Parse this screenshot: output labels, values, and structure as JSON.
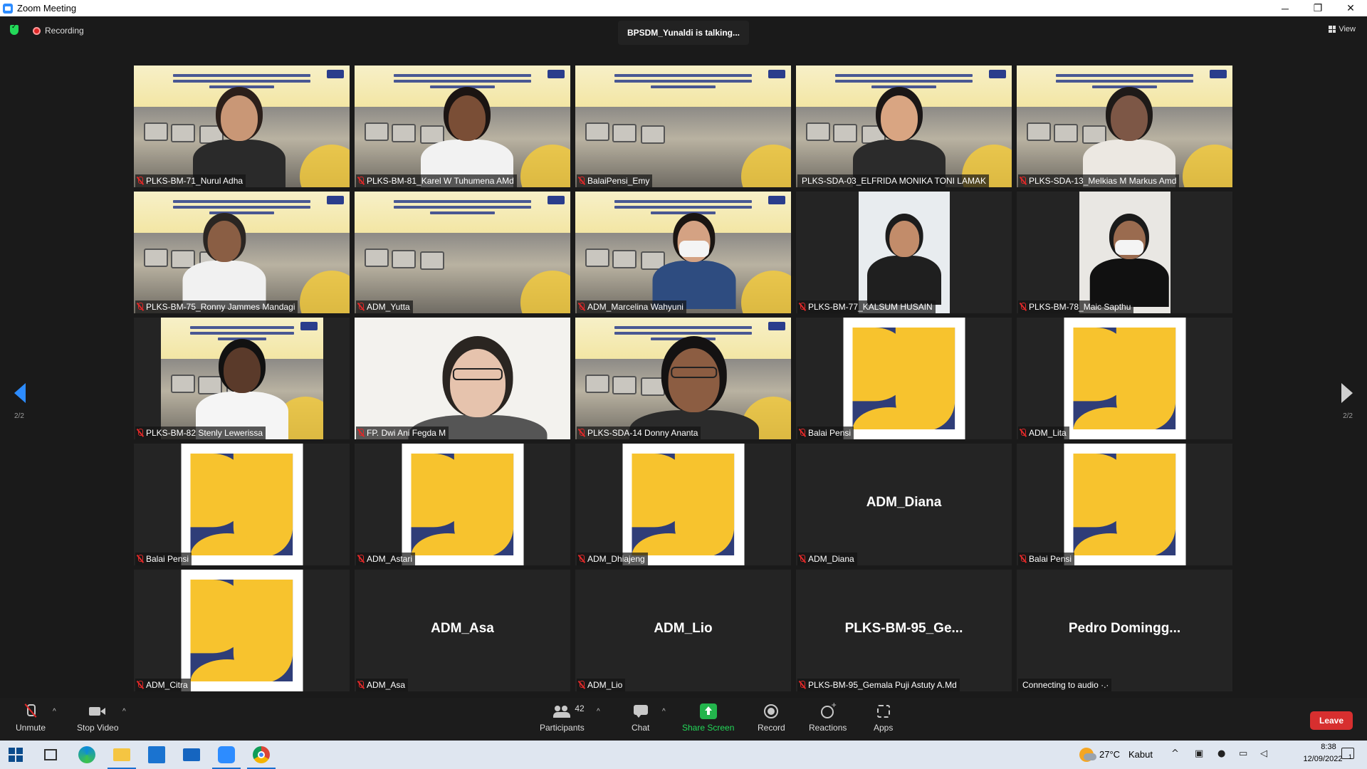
{
  "window": {
    "title": "Zoom Meeting",
    "controls": [
      "─",
      "❐",
      "✕"
    ]
  },
  "top": {
    "recording_label": "Recording",
    "talking": "BPSDM_Yunaldi is talking...",
    "view_label": "View"
  },
  "pagination": {
    "left": "2/2",
    "right": "2/2"
  },
  "colors": {
    "pu_yellow": "#f7c32e",
    "pu_blue": "#2f3d78",
    "accent": "#2d8cff",
    "leave": "#d72f2f"
  },
  "tiles": [
    {
      "name": "PLKS-BM-71_Nurul Adha",
      "kind": "video",
      "muted": true
    },
    {
      "name": "PLKS-BM-81_Karel W Tuhumena AMd",
      "kind": "video",
      "muted": true
    },
    {
      "name": "BalaiPensi_Emy",
      "kind": "video",
      "muted": true
    },
    {
      "name": "PLKS-SDA-03_ELFRIDA MONIKA TONI LAMAK",
      "kind": "video",
      "muted": false
    },
    {
      "name": "PLKS-SDA-13_Melkias M Markus Amd",
      "kind": "video",
      "muted": true
    },
    {
      "name": "PLKS-BM-75_Ronny Jammes Mandagi",
      "kind": "video",
      "muted": true
    },
    {
      "name": "ADM_Yutta",
      "kind": "video",
      "muted": true
    },
    {
      "name": "ADM_Marcelina Wahyuni",
      "kind": "video",
      "muted": true
    },
    {
      "name": "PLKS-BM-77_KALSUM HUSAIN",
      "kind": "video",
      "muted": true
    },
    {
      "name": "PLKS-BM-78_Maic Sapthu",
      "kind": "video",
      "muted": true
    },
    {
      "name": "PLKS-BM-82 Stenly Lewerissa",
      "kind": "video",
      "muted": true
    },
    {
      "name": "FP. Dwi Ani Fegda M",
      "kind": "video",
      "muted": true
    },
    {
      "name": "PLKS-SDA-14 Donny Ananta",
      "kind": "video",
      "muted": true
    },
    {
      "name": "Balai Pensi",
      "kind": "logo",
      "muted": true
    },
    {
      "name": "ADM_Lita",
      "kind": "logo",
      "muted": true
    },
    {
      "name": "Balai Pensi",
      "kind": "logo",
      "muted": true
    },
    {
      "name": "ADM_Astari",
      "kind": "logo",
      "muted": true
    },
    {
      "name": "ADM_Dhiajeng",
      "kind": "logo",
      "muted": true
    },
    {
      "name": "ADM_Diana",
      "kind": "text",
      "display": "ADM_Diana",
      "muted": true
    },
    {
      "name": "Balai Pensi",
      "kind": "logo",
      "muted": true
    },
    {
      "name": "ADM_Citra",
      "kind": "logo",
      "muted": true
    },
    {
      "name": "ADM_Asa",
      "kind": "text",
      "display": "ADM_Asa",
      "muted": true
    },
    {
      "name": "ADM_Lio",
      "kind": "text",
      "display": "ADM_Lio",
      "muted": true
    },
    {
      "name": "PLKS-BM-95_Gemala Puji Astuty A.Md",
      "kind": "text",
      "display": "PLKS-BM-95_Ge...",
      "muted": true
    },
    {
      "name": "Connecting to audio ·.·",
      "kind": "text",
      "display": "Pedro  Domingg...",
      "muted": false
    }
  ],
  "controls": {
    "unmute": "Unmute",
    "stop_video": "Stop Video",
    "participants": "Participants",
    "participants_count": "42",
    "chat": "Chat",
    "share_screen": "Share Screen",
    "record": "Record",
    "reactions": "Reactions",
    "apps": "Apps",
    "leave": "Leave"
  },
  "taskbar": {
    "weather_temp": "27°C",
    "weather_cond": "Kabut",
    "time": "8:38",
    "date": "12/09/2022",
    "notifications": "1"
  }
}
